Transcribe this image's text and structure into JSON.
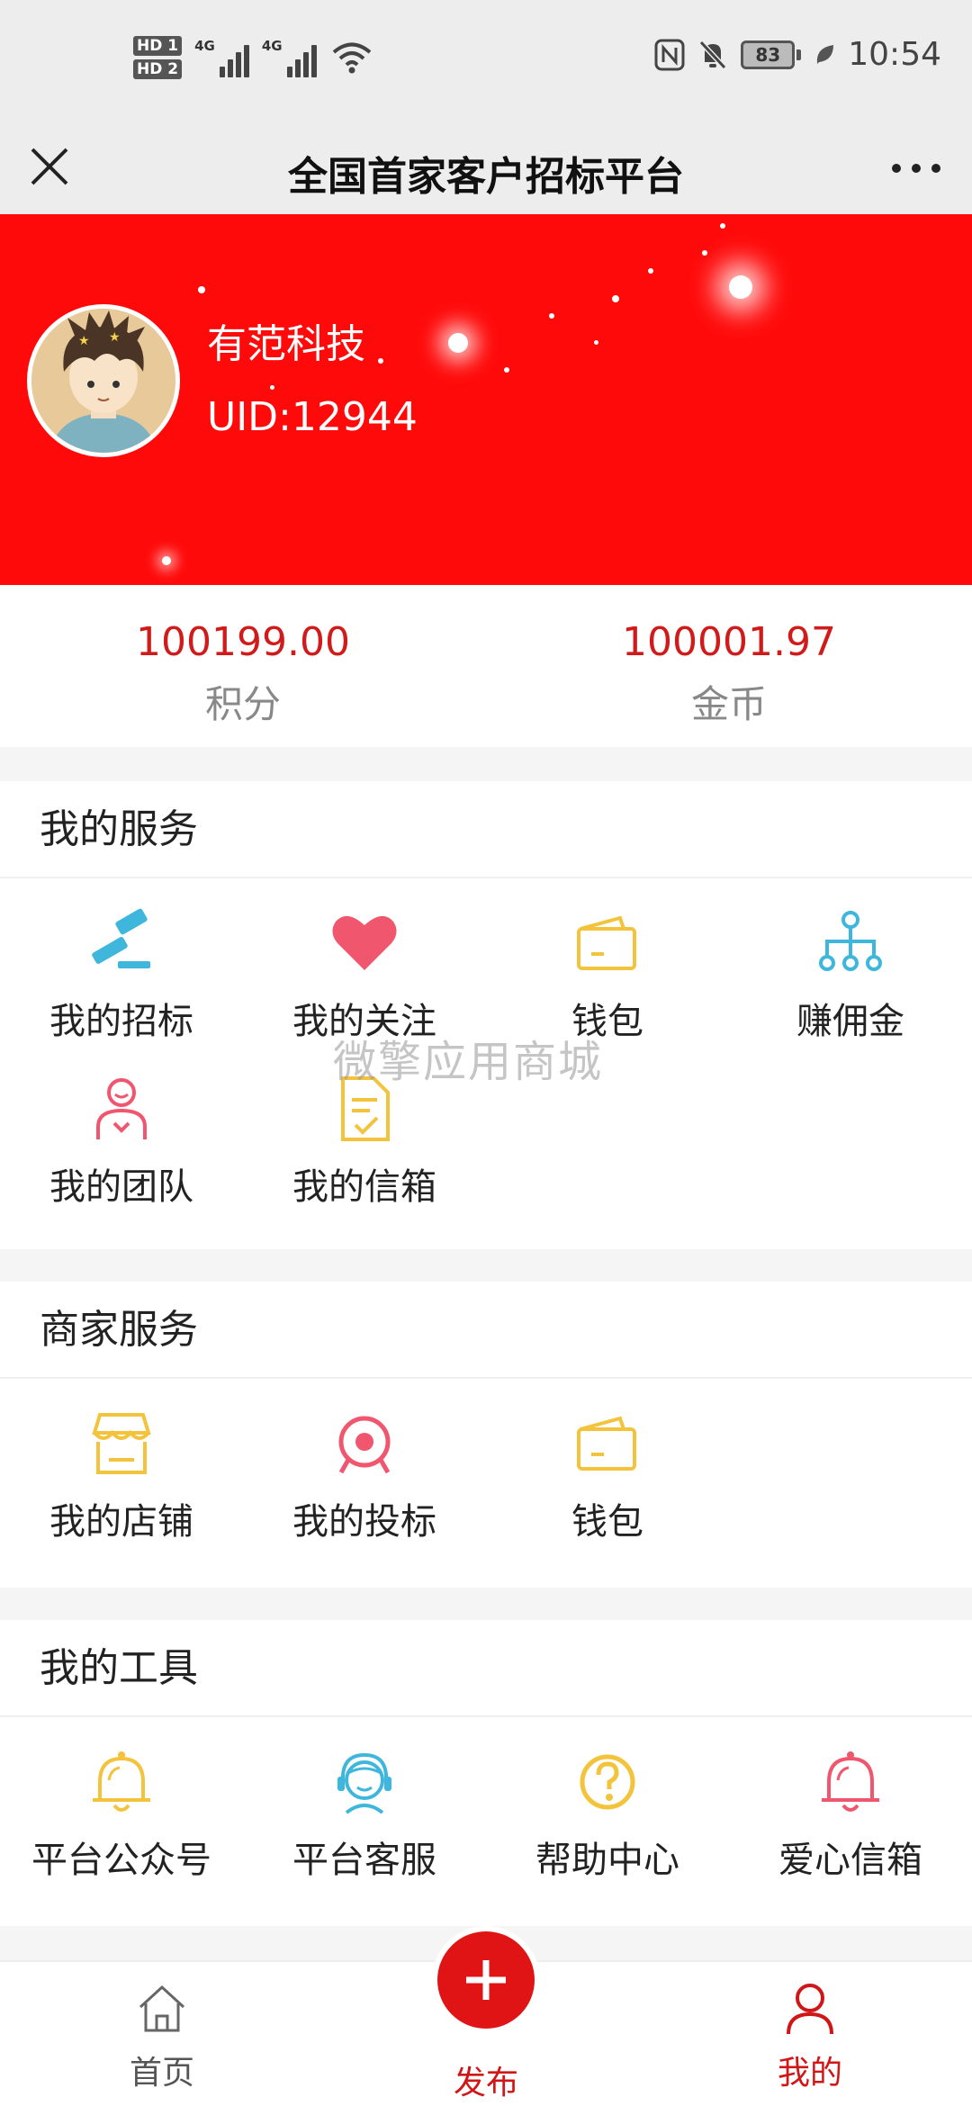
{
  "status_bar": {
    "hd1": "HD 1",
    "hd2": "HD 2",
    "net1": "4G",
    "net2": "4G",
    "battery": "83",
    "time": "10:54"
  },
  "title_bar": {
    "title": "全国首家客户招标平台"
  },
  "profile": {
    "name": "有范科技",
    "uid": "UID:12944"
  },
  "balances": [
    {
      "value": "100199.00",
      "label": "积分"
    },
    {
      "value": "100001.97",
      "label": "金币"
    }
  ],
  "my_services": {
    "title": "我的服务",
    "items": [
      {
        "label": "我的招标",
        "icon": "gavel-icon"
      },
      {
        "label": "我的关注",
        "icon": "heart-icon"
      },
      {
        "label": "钱包",
        "icon": "wallet-icon"
      },
      {
        "label": "赚佣金",
        "icon": "network-icon"
      },
      {
        "label": "我的团队",
        "icon": "team-icon"
      },
      {
        "label": "我的信箱",
        "icon": "mailbox-icon"
      }
    ]
  },
  "merchant_services": {
    "title": "商家服务",
    "items": [
      {
        "label": "我的店铺",
        "icon": "store-icon"
      },
      {
        "label": "我的投标",
        "icon": "target-icon"
      },
      {
        "label": "钱包",
        "icon": "wallet-icon"
      }
    ]
  },
  "my_tools": {
    "title": "我的工具",
    "items": [
      {
        "label": "平台公众号",
        "icon": "bell-icon"
      },
      {
        "label": "平台客服",
        "icon": "customer-service-icon"
      },
      {
        "label": "帮助中心",
        "icon": "help-icon"
      },
      {
        "label": "爱心信箱",
        "icon": "bell-icon"
      }
    ]
  },
  "watermark": "微擎应用商城",
  "bottom_nav": {
    "home": "首页",
    "publish": "发布",
    "mine": "我的"
  },
  "colors": {
    "brand_red": "#ff0a0a",
    "value_red": "#d11a1a",
    "icon_blue": "#3fb6dc",
    "icon_pink": "#f0566e",
    "icon_yellow": "#f3c33c"
  }
}
